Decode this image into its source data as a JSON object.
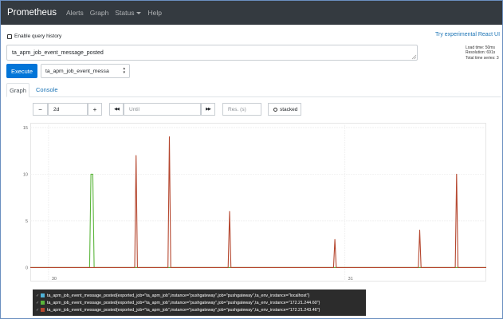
{
  "navbar": {
    "brand": "Prometheus",
    "links": [
      "Alerts",
      "Graph",
      "Status",
      "Help"
    ]
  },
  "query_history_label": "Enable query history",
  "react_ui_link": "Try experimental React UI",
  "stats": {
    "load_time": "Load time: 50ms",
    "resolution": "Resolution: 691s",
    "total_series": "Total time series: 3"
  },
  "expression": "ta_apm_job_event_message_posted",
  "execute_label": "Execute",
  "metric_select_value": "ta_apm_job_event_messa",
  "tabs": {
    "graph": "Graph",
    "console": "Console"
  },
  "controls": {
    "range_value": "2d",
    "minus": "−",
    "plus": "+",
    "back": "◀◀",
    "until_placeholder": "Until",
    "forward": "▶▶",
    "res_placeholder": "Res. (s)",
    "stacked_label": "stacked"
  },
  "chart_data": {
    "type": "line",
    "y_ticks": [
      "0",
      "5",
      "10",
      "15"
    ],
    "x_ticks": [
      "30",
      "31"
    ],
    "ylim": [
      -1.5,
      15.5
    ],
    "xlim": [
      0,
      1000
    ],
    "grid": true,
    "series": [
      {
        "label": "ta_apm_job_event_message_posted{exported_job=\"ta_apm_job\",instance=\"pushgateway\",job=\"pushgateway\",ta_env_instance=\"localhost\"}",
        "color": "#4fb3d9",
        "points": []
      },
      {
        "label": "ta_apm_job_event_message_posted{exported_job=\"ta_apm_job\",instance=\"pushgateway\",job=\"pushgateway\",ta_env_instance=\"172.21.244.60\"}",
        "color": "#5ab53a",
        "points": [
          [
            0,
            0
          ],
          [
            130,
            0
          ],
          [
            133,
            10
          ],
          [
            137,
            10
          ],
          [
            140,
            0
          ],
          [
            1000,
            0
          ]
        ]
      },
      {
        "label": "ta_apm_job_event_message_posted{exported_job=\"ta_apm_job\",instance=\"pushgateway\",job=\"pushgateway\",ta_env_instance=\"172.21.243.46\"}",
        "color": "#b5472f",
        "points": [
          [
            0,
            0
          ],
          [
            229,
            0
          ],
          [
            232,
            12
          ],
          [
            235,
            0
          ],
          [
            302,
            0
          ],
          [
            305,
            14
          ],
          [
            308,
            0
          ],
          [
            434,
            0
          ],
          [
            437,
            6
          ],
          [
            440,
            0
          ],
          [
            665,
            0
          ],
          [
            668,
            3
          ],
          [
            671,
            0
          ],
          [
            851,
            0
          ],
          [
            854,
            4
          ],
          [
            857,
            0
          ],
          [
            932,
            0
          ],
          [
            935,
            10
          ],
          [
            938,
            0
          ],
          [
            1000,
            0
          ]
        ]
      }
    ]
  }
}
